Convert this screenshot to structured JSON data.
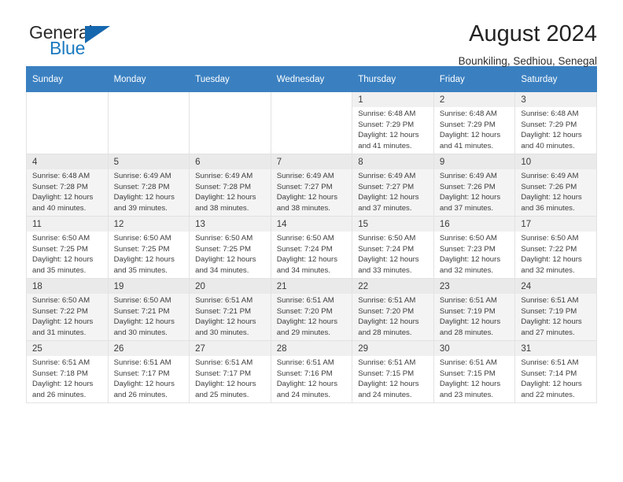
{
  "brand": {
    "name_top": "General",
    "name_bottom": "Blue",
    "accent_color": "#1567ae",
    "text_color": "#2b2b2b"
  },
  "header": {
    "title": "August 2024",
    "subtitle": "Bounkiling, Sedhiou, Senegal",
    "header_bg": "#3a80c1"
  },
  "calendar": {
    "weekday_headers": [
      "Sunday",
      "Monday",
      "Tuesday",
      "Wednesday",
      "Thursday",
      "Friday",
      "Saturday"
    ],
    "weeks": [
      [
        {
          "day": "",
          "lines": []
        },
        {
          "day": "",
          "lines": []
        },
        {
          "day": "",
          "lines": []
        },
        {
          "day": "",
          "lines": []
        },
        {
          "day": "1",
          "lines": [
            "Sunrise: 6:48 AM",
            "Sunset: 7:29 PM",
            "Daylight: 12 hours",
            "and 41 minutes."
          ]
        },
        {
          "day": "2",
          "lines": [
            "Sunrise: 6:48 AM",
            "Sunset: 7:29 PM",
            "Daylight: 12 hours",
            "and 41 minutes."
          ]
        },
        {
          "day": "3",
          "lines": [
            "Sunrise: 6:48 AM",
            "Sunset: 7:29 PM",
            "Daylight: 12 hours",
            "and 40 minutes."
          ]
        }
      ],
      [
        {
          "day": "4",
          "lines": [
            "Sunrise: 6:48 AM",
            "Sunset: 7:28 PM",
            "Daylight: 12 hours",
            "and 40 minutes."
          ]
        },
        {
          "day": "5",
          "lines": [
            "Sunrise: 6:49 AM",
            "Sunset: 7:28 PM",
            "Daylight: 12 hours",
            "and 39 minutes."
          ]
        },
        {
          "day": "6",
          "lines": [
            "Sunrise: 6:49 AM",
            "Sunset: 7:28 PM",
            "Daylight: 12 hours",
            "and 38 minutes."
          ]
        },
        {
          "day": "7",
          "lines": [
            "Sunrise: 6:49 AM",
            "Sunset: 7:27 PM",
            "Daylight: 12 hours",
            "and 38 minutes."
          ]
        },
        {
          "day": "8",
          "lines": [
            "Sunrise: 6:49 AM",
            "Sunset: 7:27 PM",
            "Daylight: 12 hours",
            "and 37 minutes."
          ]
        },
        {
          "day": "9",
          "lines": [
            "Sunrise: 6:49 AM",
            "Sunset: 7:26 PM",
            "Daylight: 12 hours",
            "and 37 minutes."
          ]
        },
        {
          "day": "10",
          "lines": [
            "Sunrise: 6:49 AM",
            "Sunset: 7:26 PM",
            "Daylight: 12 hours",
            "and 36 minutes."
          ]
        }
      ],
      [
        {
          "day": "11",
          "lines": [
            "Sunrise: 6:50 AM",
            "Sunset: 7:25 PM",
            "Daylight: 12 hours",
            "and 35 minutes."
          ]
        },
        {
          "day": "12",
          "lines": [
            "Sunrise: 6:50 AM",
            "Sunset: 7:25 PM",
            "Daylight: 12 hours",
            "and 35 minutes."
          ]
        },
        {
          "day": "13",
          "lines": [
            "Sunrise: 6:50 AM",
            "Sunset: 7:25 PM",
            "Daylight: 12 hours",
            "and 34 minutes."
          ]
        },
        {
          "day": "14",
          "lines": [
            "Sunrise: 6:50 AM",
            "Sunset: 7:24 PM",
            "Daylight: 12 hours",
            "and 34 minutes."
          ]
        },
        {
          "day": "15",
          "lines": [
            "Sunrise: 6:50 AM",
            "Sunset: 7:24 PM",
            "Daylight: 12 hours",
            "and 33 minutes."
          ]
        },
        {
          "day": "16",
          "lines": [
            "Sunrise: 6:50 AM",
            "Sunset: 7:23 PM",
            "Daylight: 12 hours",
            "and 32 minutes."
          ]
        },
        {
          "day": "17",
          "lines": [
            "Sunrise: 6:50 AM",
            "Sunset: 7:22 PM",
            "Daylight: 12 hours",
            "and 32 minutes."
          ]
        }
      ],
      [
        {
          "day": "18",
          "lines": [
            "Sunrise: 6:50 AM",
            "Sunset: 7:22 PM",
            "Daylight: 12 hours",
            "and 31 minutes."
          ]
        },
        {
          "day": "19",
          "lines": [
            "Sunrise: 6:50 AM",
            "Sunset: 7:21 PM",
            "Daylight: 12 hours",
            "and 30 minutes."
          ]
        },
        {
          "day": "20",
          "lines": [
            "Sunrise: 6:51 AM",
            "Sunset: 7:21 PM",
            "Daylight: 12 hours",
            "and 30 minutes."
          ]
        },
        {
          "day": "21",
          "lines": [
            "Sunrise: 6:51 AM",
            "Sunset: 7:20 PM",
            "Daylight: 12 hours",
            "and 29 minutes."
          ]
        },
        {
          "day": "22",
          "lines": [
            "Sunrise: 6:51 AM",
            "Sunset: 7:20 PM",
            "Daylight: 12 hours",
            "and 28 minutes."
          ]
        },
        {
          "day": "23",
          "lines": [
            "Sunrise: 6:51 AM",
            "Sunset: 7:19 PM",
            "Daylight: 12 hours",
            "and 28 minutes."
          ]
        },
        {
          "day": "24",
          "lines": [
            "Sunrise: 6:51 AM",
            "Sunset: 7:19 PM",
            "Daylight: 12 hours",
            "and 27 minutes."
          ]
        }
      ],
      [
        {
          "day": "25",
          "lines": [
            "Sunrise: 6:51 AM",
            "Sunset: 7:18 PM",
            "Daylight: 12 hours",
            "and 26 minutes."
          ]
        },
        {
          "day": "26",
          "lines": [
            "Sunrise: 6:51 AM",
            "Sunset: 7:17 PM",
            "Daylight: 12 hours",
            "and 26 minutes."
          ]
        },
        {
          "day": "27",
          "lines": [
            "Sunrise: 6:51 AM",
            "Sunset: 7:17 PM",
            "Daylight: 12 hours",
            "and 25 minutes."
          ]
        },
        {
          "day": "28",
          "lines": [
            "Sunrise: 6:51 AM",
            "Sunset: 7:16 PM",
            "Daylight: 12 hours",
            "and 24 minutes."
          ]
        },
        {
          "day": "29",
          "lines": [
            "Sunrise: 6:51 AM",
            "Sunset: 7:15 PM",
            "Daylight: 12 hours",
            "and 24 minutes."
          ]
        },
        {
          "day": "30",
          "lines": [
            "Sunrise: 6:51 AM",
            "Sunset: 7:15 PM",
            "Daylight: 12 hours",
            "and 23 minutes."
          ]
        },
        {
          "day": "31",
          "lines": [
            "Sunrise: 6:51 AM",
            "Sunset: 7:14 PM",
            "Daylight: 12 hours",
            "and 22 minutes."
          ]
        }
      ]
    ]
  }
}
